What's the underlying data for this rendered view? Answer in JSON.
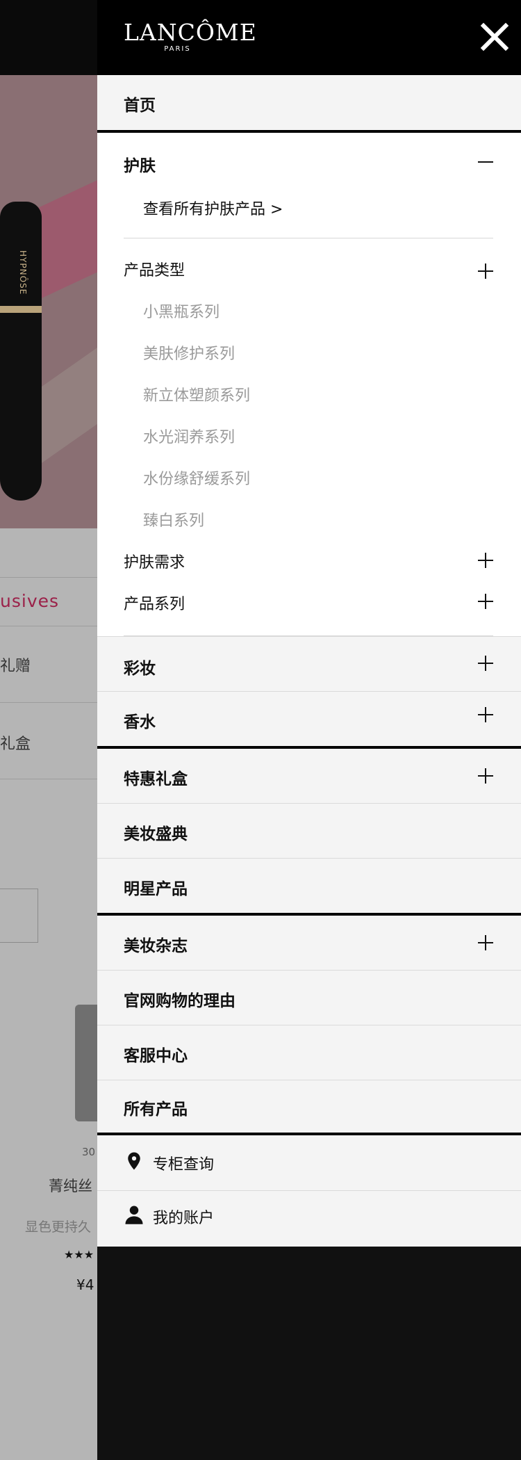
{
  "background_page": {
    "hero_product_text": "HYPNÔSE",
    "exclusives_text": "usives",
    "gift_line_1": "礼赠",
    "gift_line_2": "礼盒",
    "product": {
      "size": "30",
      "name": "菁纯丝",
      "description": "显色更持久",
      "rating_stars": "★★★",
      "price": "¥4"
    }
  },
  "header": {
    "brand": "LANCÔME",
    "brand_hat": "^",
    "city": "PARIS",
    "close_icon": "close-icon"
  },
  "menu": {
    "home": "首页",
    "skincare": "护肤",
    "view_all_skincare": "查看所有护肤产品 >",
    "product_type": {
      "label": "产品类型",
      "items": [
        "小黑瓶系列",
        "美肤修护系列",
        "新立体塑颜系列",
        "水光润养系列",
        "水份缘舒缓系列",
        "臻白系列"
      ]
    },
    "skin_needs": "护肤需求",
    "product_series": "产品系列",
    "makeup": "彩妆",
    "fragrance": "香水",
    "special_gift_boxes": "特惠礼盒",
    "beauty_festival": "美妆盛典",
    "star_products": "明星产品",
    "beauty_magazine": "美妆杂志",
    "why_shop_official": "官网购物的理由",
    "customer_service": "客服中心",
    "all_products": "所有产品"
  },
  "utility_links": {
    "store_locator": "专柜查询",
    "store_locator_icon": "location-pin-icon",
    "my_account": "我的账户",
    "my_account_icon": "user-icon"
  },
  "colors": {
    "header_bg": "#000000",
    "menu_bg": "#f4f4f4",
    "panel_bg": "#ffffff",
    "muted_text": "#9a9a9a",
    "accent": "#9b2149"
  }
}
